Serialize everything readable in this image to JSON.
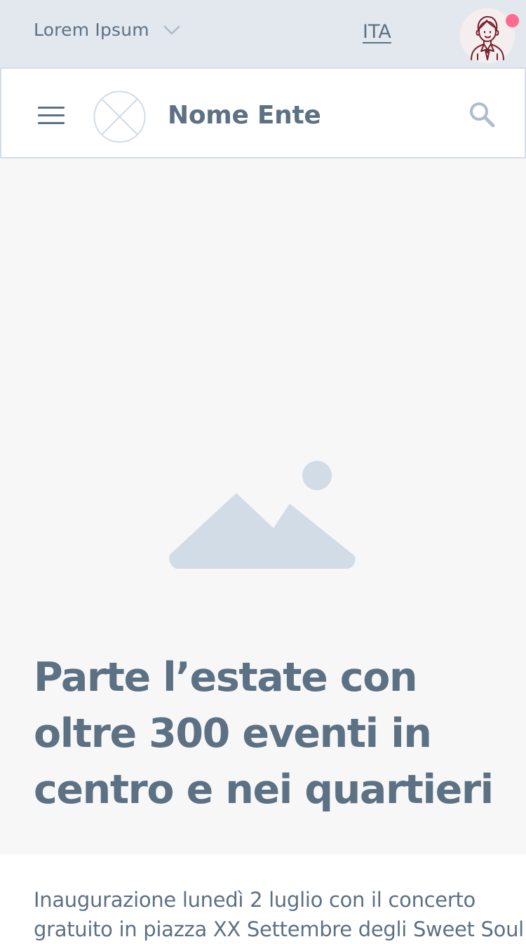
{
  "topbar": {
    "org_label": "Lorem Ipsum",
    "org_icon": "chevron-down-icon",
    "language": "ITA",
    "avatar_icon": "user-avatar-icon",
    "notification_color": "#ff6a8f"
  },
  "header": {
    "menu_icon": "hamburger-menu-icon",
    "logo_icon": "placeholder-logo-icon",
    "site_name": "Nome Ente",
    "search_icon": "search-icon"
  },
  "hero": {
    "image_icon": "image-placeholder-icon",
    "title": "Parte l’estate con oltre 300 eventi in centro e nei quartieri"
  },
  "article": {
    "lead": "Inaugurazione lunedì 2 luglio con il concerto gratuito in piazza XX Settembre degli Sweet Soul"
  },
  "colors": {
    "primary_text": "#5c7184",
    "topbar_bg": "#e3e8ef",
    "hero_bg": "#f7f7f7",
    "placeholder": "#d1dce6"
  }
}
